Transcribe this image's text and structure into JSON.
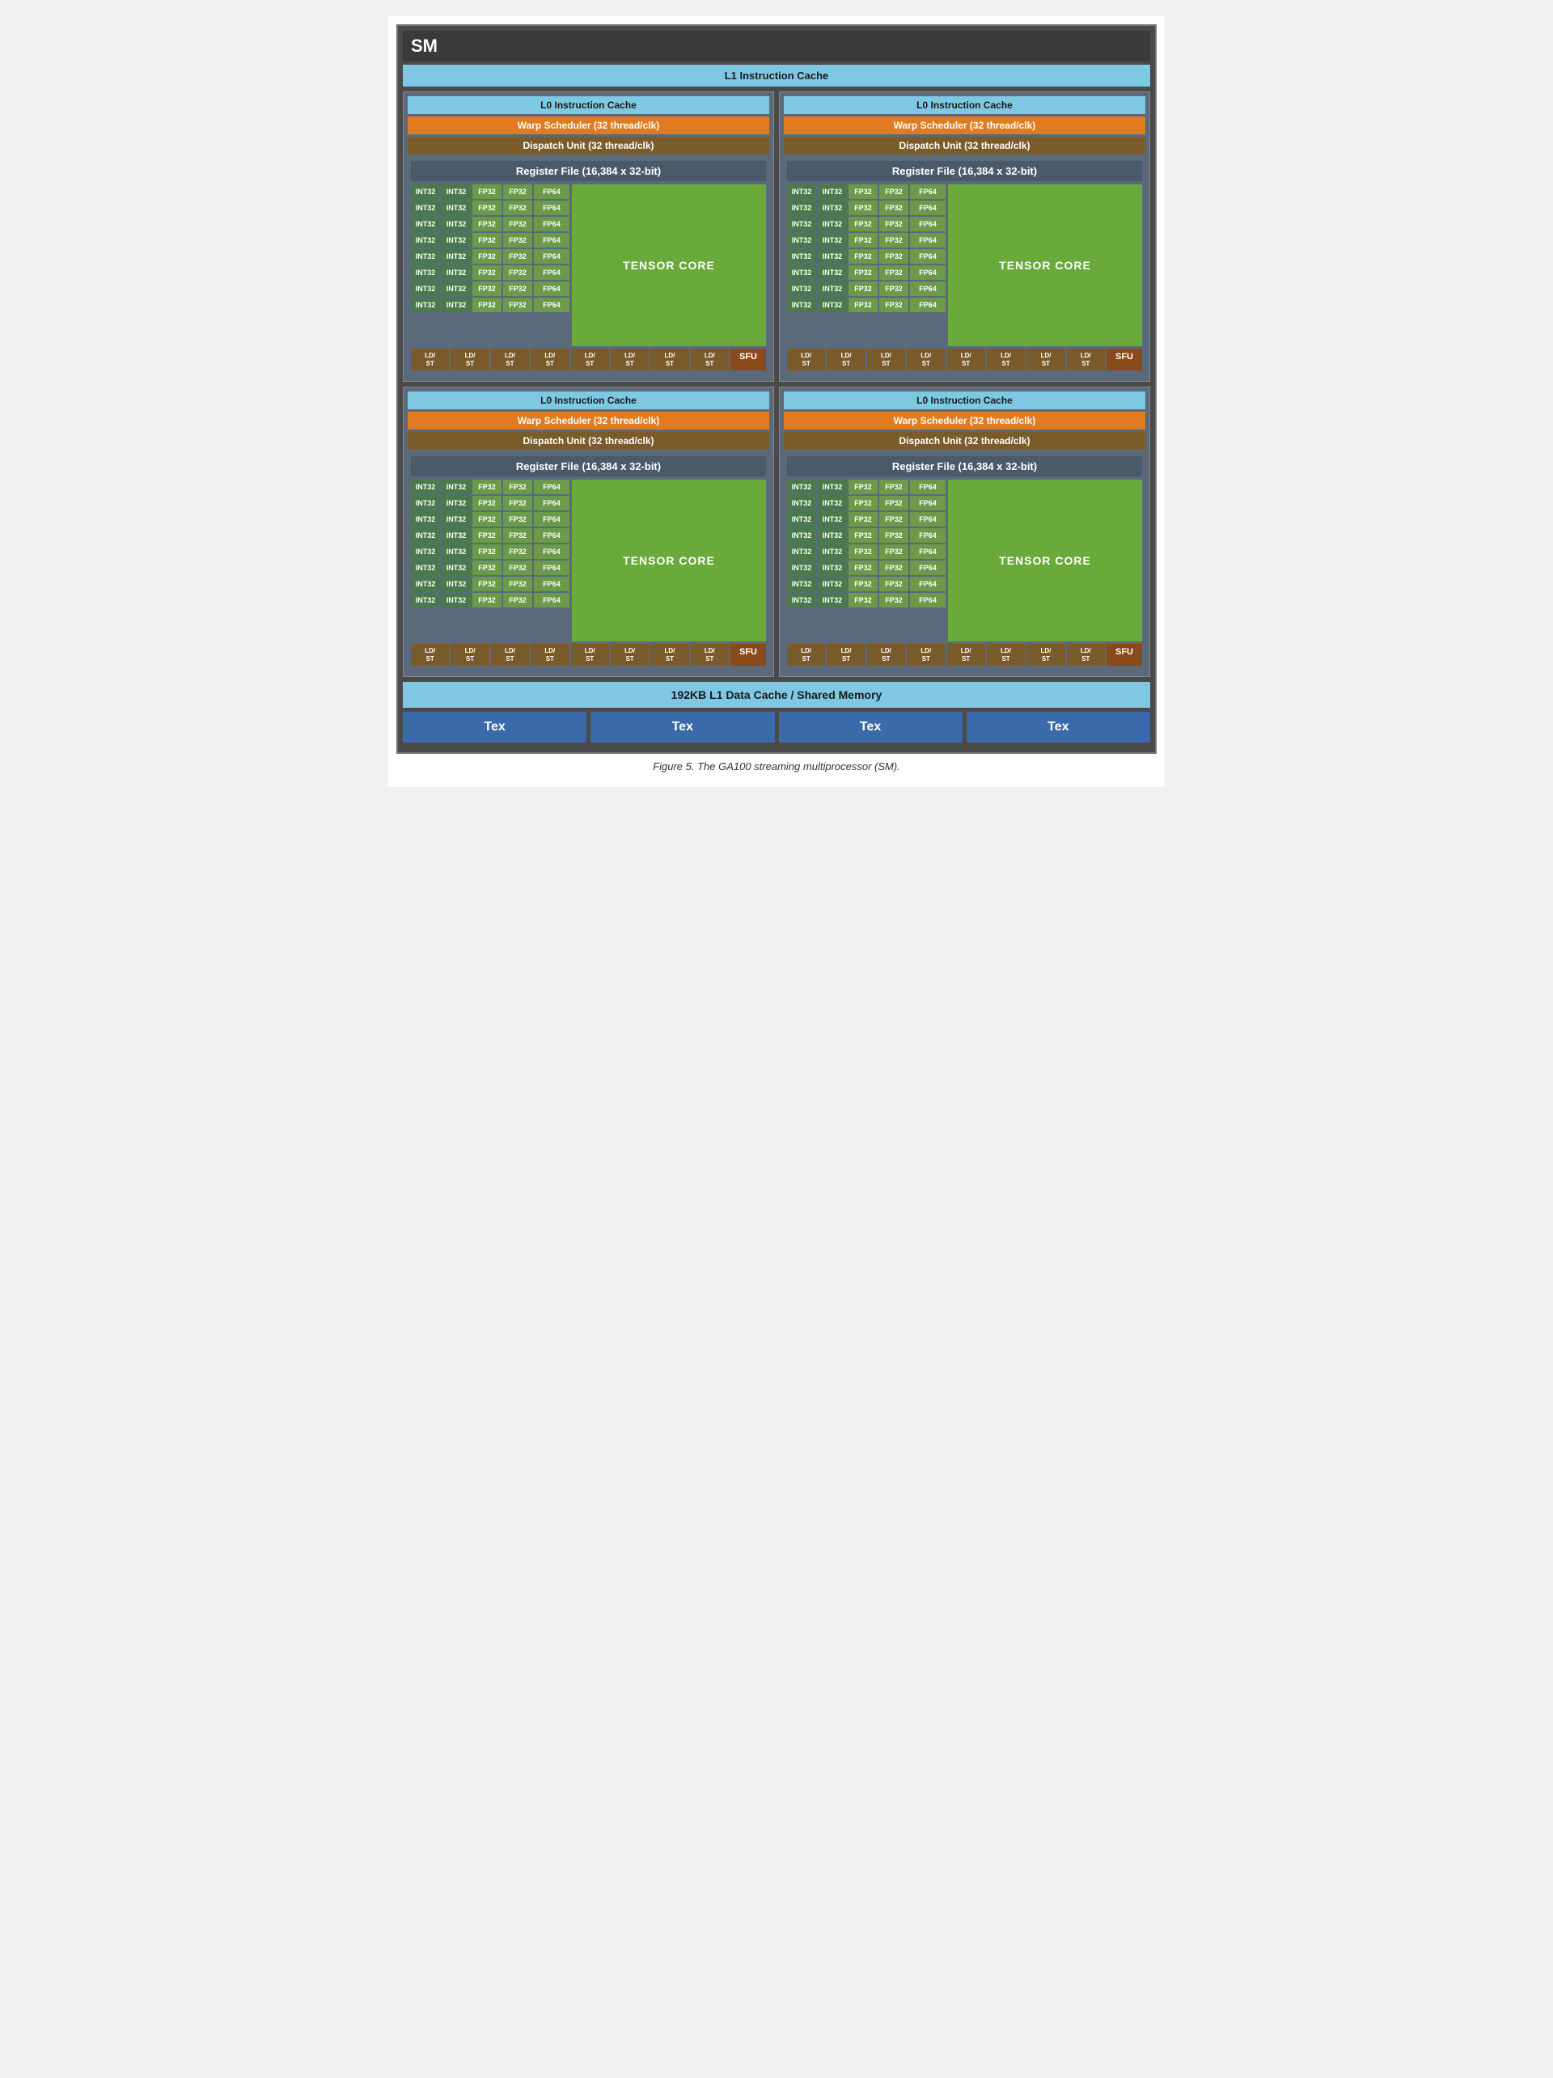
{
  "sm_title": "SM",
  "l1_instruction_cache": "L1 Instruction Cache",
  "sub_processors": [
    {
      "l0_cache": "L0 Instruction Cache",
      "warp_scheduler": "Warp Scheduler (32 thread/clk)",
      "dispatch_unit": "Dispatch Unit (32 thread/clk)",
      "register_file": "Register File (16,384 x 32-bit)",
      "tensor_core": "TENSOR CORE",
      "rows": 8,
      "int_units": [
        "INT32",
        "INT32"
      ],
      "fp32_units": [
        "FP32",
        "FP32"
      ],
      "fp64_unit": "FP64",
      "ldst_count": 8,
      "ldst_label": "LD/\nST",
      "sfu": "SFU"
    },
    {
      "l0_cache": "L0 Instruction Cache",
      "warp_scheduler": "Warp Scheduler (32 thread/clk)",
      "dispatch_unit": "Dispatch Unit (32 thread/clk)",
      "register_file": "Register File (16,384 x 32-bit)",
      "tensor_core": "TENSOR CORE",
      "rows": 8,
      "int_units": [
        "INT32",
        "INT32"
      ],
      "fp32_units": [
        "FP32",
        "FP32"
      ],
      "fp64_unit": "FP64",
      "ldst_count": 8,
      "ldst_label": "LD/\nST",
      "sfu": "SFU"
    },
    {
      "l0_cache": "L0 Instruction Cache",
      "warp_scheduler": "Warp Scheduler (32 thread/clk)",
      "dispatch_unit": "Dispatch Unit (32 thread/clk)",
      "register_file": "Register File (16,384 x 32-bit)",
      "tensor_core": "TENSOR CORE",
      "rows": 8,
      "int_units": [
        "INT32",
        "INT32"
      ],
      "fp32_units": [
        "FP32",
        "FP32"
      ],
      "fp64_unit": "FP64",
      "ldst_count": 8,
      "ldst_label": "LD/\nST",
      "sfu": "SFU"
    },
    {
      "l0_cache": "L0 Instruction Cache",
      "warp_scheduler": "Warp Scheduler (32 thread/clk)",
      "dispatch_unit": "Dispatch Unit (32 thread/clk)",
      "register_file": "Register File (16,384 x 32-bit)",
      "tensor_core": "TENSOR CORE",
      "rows": 8,
      "int_units": [
        "INT32",
        "INT32"
      ],
      "fp32_units": [
        "FP32",
        "FP32"
      ],
      "fp64_unit": "FP64",
      "ldst_count": 8,
      "ldst_label": "LD/\nST",
      "sfu": "SFU"
    }
  ],
  "l1_data_cache": "192KB L1 Data Cache / Shared Memory",
  "tex_units": [
    "Tex",
    "Tex",
    "Tex",
    "Tex"
  ],
  "figure_caption": "Figure 5. The GA100 streaming multiprocessor (SM)."
}
